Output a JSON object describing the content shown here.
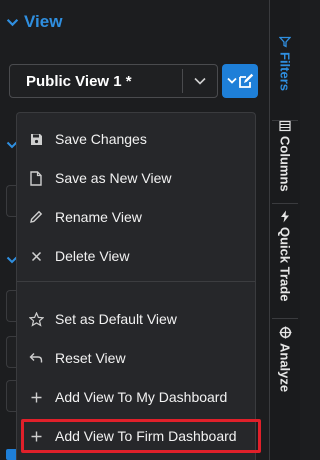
{
  "section": {
    "title": "View"
  },
  "view_select": {
    "value": "Public View 1 *"
  },
  "menu": {
    "group1": [
      {
        "label": "Save Changes",
        "icon": "save-icon"
      },
      {
        "label": "Save as New View",
        "icon": "file-icon"
      },
      {
        "label": "Rename View",
        "icon": "pencil-icon"
      },
      {
        "label": "Delete View",
        "icon": "x-icon"
      }
    ],
    "group2": [
      {
        "label": "Set as Default View",
        "icon": "star-icon"
      },
      {
        "label": "Reset View",
        "icon": "undo-icon"
      },
      {
        "label": "Add View To My Dashboard",
        "icon": "plus-icon"
      },
      {
        "label": "Add View To Firm Dashboard",
        "icon": "plus-icon"
      }
    ]
  },
  "rail": {
    "filters": "Filters",
    "columns": "Columns",
    "quick_trade": "Quick Trade",
    "analyze": "Analyze"
  },
  "colors": {
    "accent": "#1e7fd8",
    "highlight": "#e0202a",
    "background": "#1c1d1f"
  }
}
